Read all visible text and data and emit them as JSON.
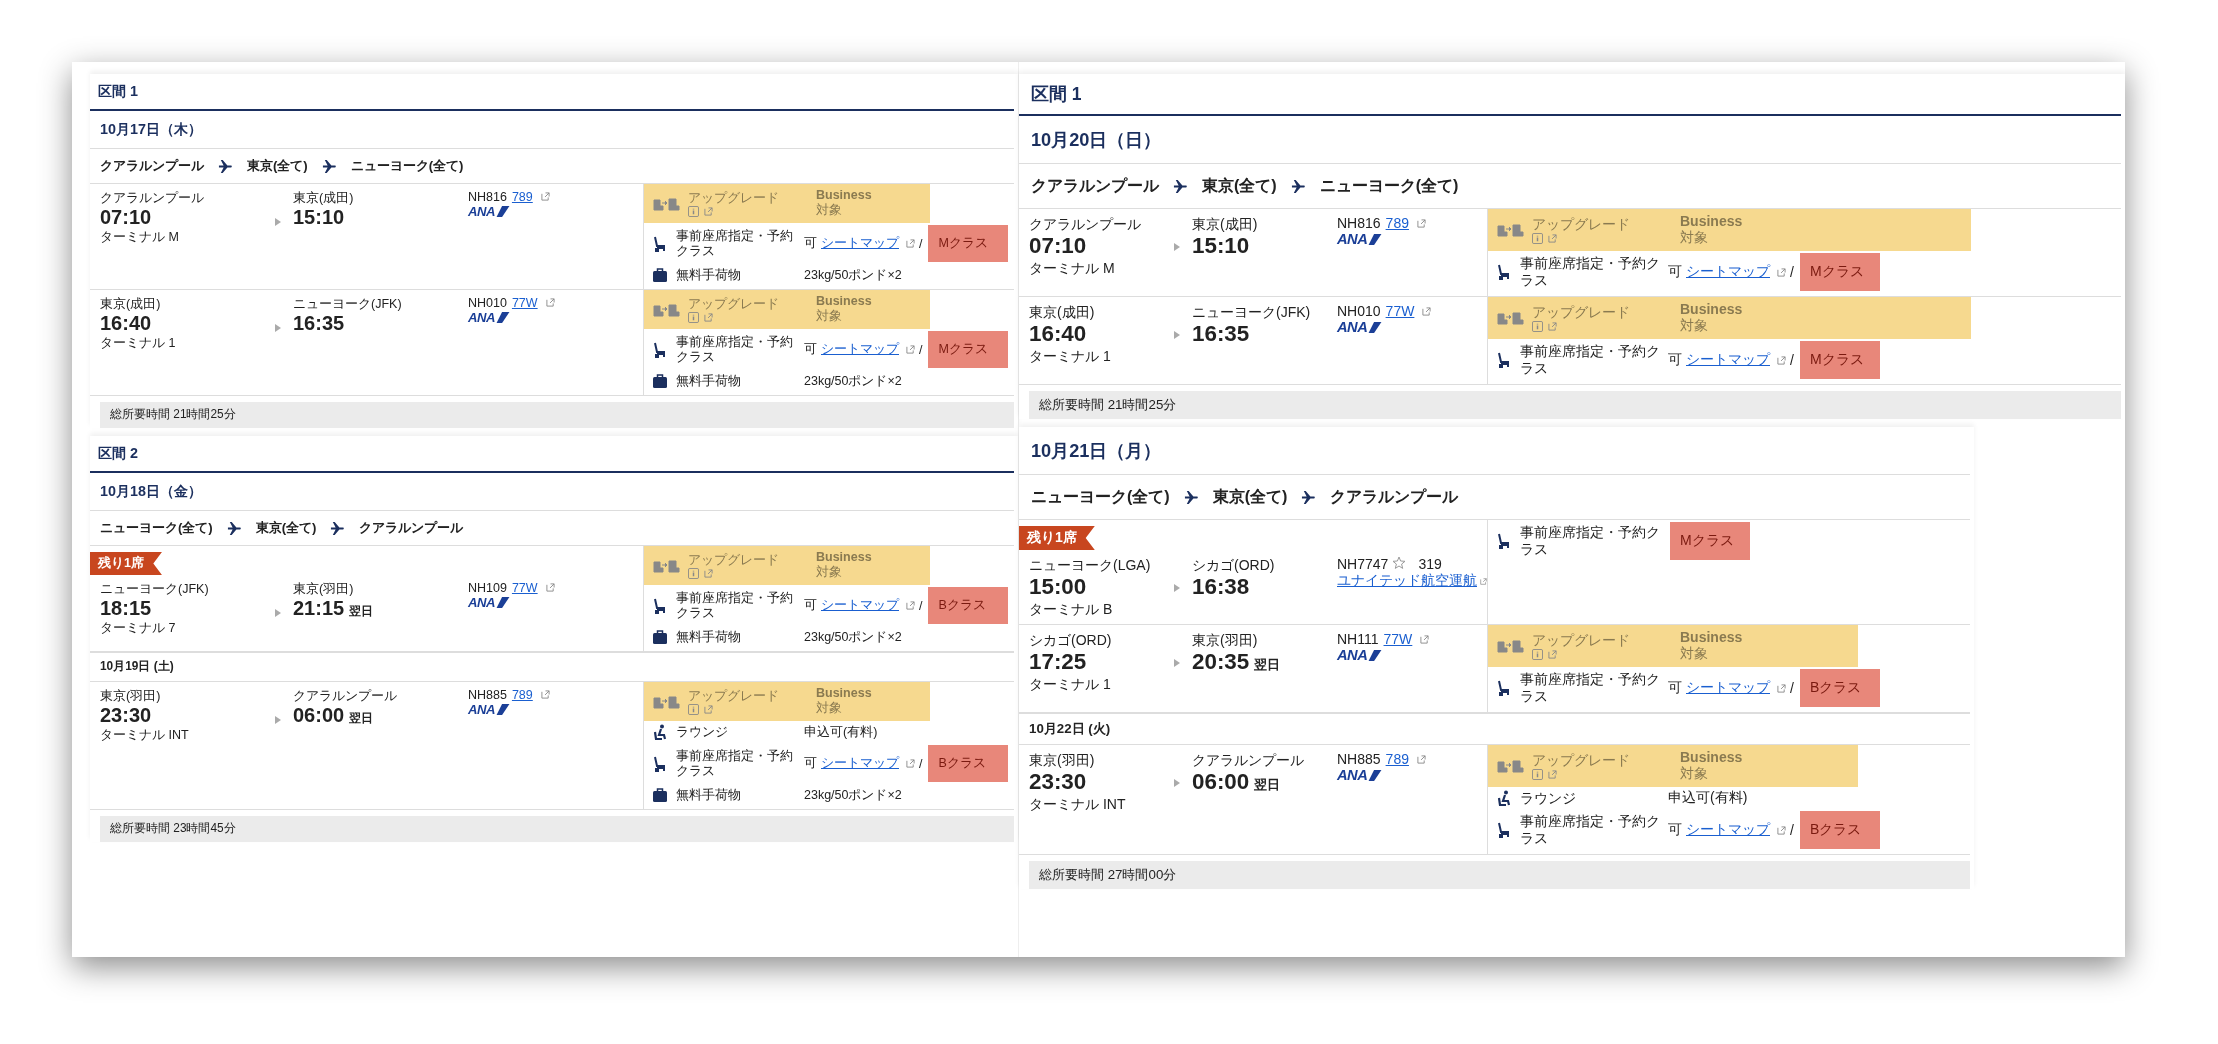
{
  "panels": [
    {
      "sections": [
        {
          "heading": "区間 1",
          "date": "10月17日（木）",
          "route": [
            "クアラルンプール",
            "東京(全て)",
            "ニューヨーク(全て)"
          ],
          "flights": [
            {
              "dep_city": "クアラルンプール",
              "dep_time": "07:10",
              "dep_terminal": "ターミナル M",
              "arr_city": "東京(成田)",
              "arr_time": "15:10",
              "flight_no": "NH816",
              "aircraft": "789",
              "aircraft_link": true,
              "logo": "ANA",
              "services": [
                {
                  "kind": "upgrade",
                  "label": "アップグレード",
                  "value": "Business",
                  "note": "対象",
                  "highlighted": true
                },
                {
                  "kind": "seat",
                  "label": "事前座席指定・予約クラス",
                  "availability": "可",
                  "link": "シートマップ",
                  "slash": "/",
                  "class": "Mクラス",
                  "marked": true
                },
                {
                  "kind": "baggage",
                  "label": "無料手荷物",
                  "value": "23kg/50ポンド×2"
                }
              ]
            },
            {
              "dep_city": "東京(成田)",
              "dep_time": "16:40",
              "dep_terminal": "ターミナル 1",
              "arr_city": "ニューヨーク(JFK)",
              "arr_time": "16:35",
              "flight_no": "NH010",
              "aircraft": "77W",
              "aircraft_link": true,
              "logo": "ANA",
              "services": [
                {
                  "kind": "upgrade",
                  "label": "アップグレード",
                  "value": "Business",
                  "note": "対象",
                  "highlighted": true
                },
                {
                  "kind": "seat",
                  "label": "事前座席指定・予約クラス",
                  "availability": "可",
                  "link": "シートマップ",
                  "slash": "/",
                  "class": "Mクラス",
                  "marked": true
                },
                {
                  "kind": "baggage",
                  "label": "無料手荷物",
                  "value": "23kg/50ポンド×2"
                }
              ]
            }
          ],
          "total": "総所要時間 21時間25分"
        },
        {
          "heading": "区間 2",
          "date": "10月18日（金）",
          "route": [
            "ニューヨーク(全て)",
            "東京(全て)",
            "クアラルンプール"
          ],
          "flights": [
            {
              "badge": "残り1席",
              "dep_city": "ニューヨーク(JFK)",
              "dep_time": "18:15",
              "dep_terminal": "ターミナル 7",
              "arr_city": "東京(羽田)",
              "arr_time": "21:15",
              "next_day": "翌日",
              "flight_no": "NH109",
              "aircraft": "77W",
              "aircraft_link": true,
              "logo": "ANA",
              "services": [
                {
                  "kind": "upgrade",
                  "label": "アップグレード",
                  "value": "Business",
                  "note": "対象",
                  "highlighted": true
                },
                {
                  "kind": "seat",
                  "label": "事前座席指定・予約クラス",
                  "availability": "可",
                  "link": "シートマップ",
                  "slash": "/",
                  "class": "Bクラス",
                  "marked": true
                },
                {
                  "kind": "baggage",
                  "label": "無料手荷物",
                  "value": "23kg/50ポンド×2"
                }
              ]
            },
            {
              "date_before": "10月19日 (土)",
              "dep_city": "東京(羽田)",
              "dep_time": "23:30",
              "dep_terminal": "ターミナル INT",
              "arr_city": "クアラルンプール",
              "arr_time": "06:00",
              "next_day": "翌日",
              "flight_no": "NH885",
              "aircraft": "789",
              "aircraft_link": true,
              "logo": "ANA",
              "services": [
                {
                  "kind": "upgrade",
                  "label": "アップグレード",
                  "value": "Business",
                  "note": "対象",
                  "highlighted": true
                },
                {
                  "kind": "lounge",
                  "label": "ラウンジ",
                  "value": "申込可(有料)"
                },
                {
                  "kind": "seat",
                  "label": "事前座席指定・予約クラス",
                  "availability": "可",
                  "link": "シートマップ",
                  "slash": "/",
                  "class": "Bクラス",
                  "marked": true
                },
                {
                  "kind": "baggage",
                  "label": "無料手荷物",
                  "value": "23kg/50ポンド×2"
                }
              ]
            }
          ],
          "total": "総所要時間 23時間45分"
        }
      ]
    },
    {
      "sections": [
        {
          "heading": "区間 1",
          "date": "10月20日（日）",
          "route": [
            "クアラルンプール",
            "東京(全て)",
            "ニューヨーク(全て)"
          ],
          "flights": [
            {
              "dep_city": "クアラルンプール",
              "dep_time": "07:10",
              "dep_terminal": "ターミナル M",
              "arr_city": "東京(成田)",
              "arr_time": "15:10",
              "flight_no": "NH816",
              "aircraft": "789",
              "aircraft_link": true,
              "logo": "ANA",
              "services": [
                {
                  "kind": "upgrade",
                  "label": "アップグレード",
                  "value": "Business",
                  "note": "対象",
                  "highlighted": true
                },
                {
                  "kind": "seat",
                  "label": "事前座席指定・予約クラス",
                  "availability": "可",
                  "link": "シートマップ",
                  "slash": "/",
                  "class": "Mクラス",
                  "marked": true
                }
              ]
            },
            {
              "dep_city": "東京(成田)",
              "dep_time": "16:40",
              "dep_terminal": "ターミナル 1",
              "arr_city": "ニューヨーク(JFK)",
              "arr_time": "16:35",
              "flight_no": "NH010",
              "aircraft": "77W",
              "aircraft_link": true,
              "logo": "ANA",
              "services": [
                {
                  "kind": "upgrade",
                  "label": "アップグレード",
                  "value": "Business",
                  "note": "対象",
                  "highlighted": true
                },
                {
                  "kind": "seat",
                  "label": "事前座席指定・予約クラス",
                  "availability": "可",
                  "link": "シートマップ",
                  "slash": "/",
                  "class": "Mクラス",
                  "marked": true
                }
              ]
            }
          ],
          "total": "総所要時間 21時間25分"
        },
        {
          "date": "10月21日（月）",
          "route": [
            "ニューヨーク(全て)",
            "東京(全て)",
            "クアラルンプール"
          ],
          "flights": [
            {
              "badge": "残り1席",
              "dep_city": "ニューヨーク(LGA)",
              "dep_time": "15:00",
              "dep_terminal": "ターミナル B",
              "arr_city": "シカゴ(ORD)",
              "arr_time": "16:38",
              "flight_no": "NH7747",
              "alliance": true,
              "aircraft": "319",
              "aircraft_link": false,
              "operator": "ユナイテッド航空運航",
              "services": [
                {
                  "kind": "seat",
                  "label": "事前座席指定・予約クラス",
                  "class": "Mクラス",
                  "marked": true
                }
              ]
            },
            {
              "dep_city": "シカゴ(ORD)",
              "dep_time": "17:25",
              "dep_terminal": "ターミナル 1",
              "arr_city": "東京(羽田)",
              "arr_time": "20:35",
              "next_day": "翌日",
              "flight_no": "NH111",
              "aircraft": "77W",
              "aircraft_link": true,
              "logo": "ANA",
              "services": [
                {
                  "kind": "upgrade",
                  "label": "アップグレード",
                  "value": "Business",
                  "note": "対象",
                  "highlighted": true
                },
                {
                  "kind": "seat",
                  "label": "事前座席指定・予約クラス",
                  "availability": "可",
                  "link": "シートマップ",
                  "slash": "/",
                  "class": "Bクラス",
                  "marked": true
                }
              ]
            },
            {
              "date_before": "10月22日 (火)",
              "dep_city": "東京(羽田)",
              "dep_time": "23:30",
              "dep_terminal": "ターミナル INT",
              "arr_city": "クアラルンプール",
              "arr_time": "06:00",
              "next_day": "翌日",
              "flight_no": "NH885",
              "aircraft": "789",
              "aircraft_link": true,
              "logo": "ANA",
              "services": [
                {
                  "kind": "upgrade",
                  "label": "アップグレード",
                  "value": "Business",
                  "note": "対象",
                  "highlighted": true
                },
                {
                  "kind": "lounge",
                  "label": "ラウンジ",
                  "value": "申込可(有料)"
                },
                {
                  "kind": "seat",
                  "label": "事前座席指定・予約クラス",
                  "availability": "可",
                  "link": "シートマップ",
                  "slash": "/",
                  "class": "Bクラス",
                  "marked": true
                }
              ]
            }
          ],
          "total": "総所要時間 27時間00分"
        }
      ]
    }
  ]
}
